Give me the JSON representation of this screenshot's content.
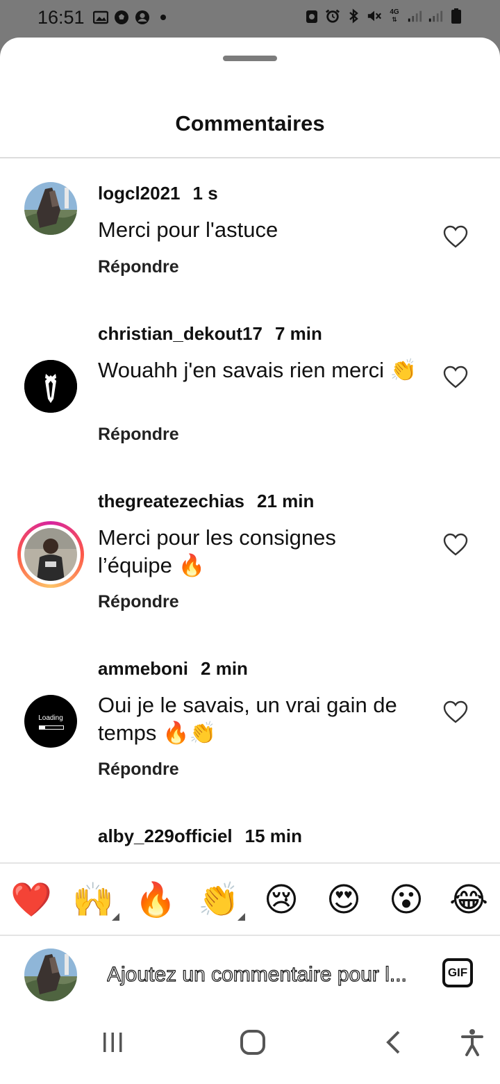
{
  "status_bar": {
    "time": "16:51",
    "left_icons": [
      "gallery-icon",
      "soccer-ball-icon",
      "account-circle-icon",
      "dot-icon"
    ],
    "right_icons": [
      "recycle-icon",
      "alarm-icon",
      "bluetooth-icon",
      "mute-icon",
      "4g-icon",
      "signal-icon",
      "signal-icon",
      "battery-icon"
    ],
    "network": "4G"
  },
  "sheet": {
    "title": "Commentaires"
  },
  "comments": [
    {
      "username": "logcl2021",
      "time": "1 s",
      "text": "Merci pour l'astuce",
      "reply": "Répondre",
      "avatar": "photo"
    },
    {
      "username": "christian_dekout17",
      "time": "7 min",
      "text": "Wouahh j'en savais rien merci 👏",
      "reply": "Répondre",
      "avatar": "tuxedo"
    },
    {
      "username": "thegreatezechias",
      "time": "21 min",
      "text": "Merci pour les consignes l’équipe 🔥",
      "reply": "Répondre",
      "avatar": "story"
    },
    {
      "username": "ammeboni",
      "time": "2 min",
      "text": "Oui je le savais, un vrai gain de temps 🔥👏",
      "reply": "Répondre",
      "avatar": "loading",
      "avatar_text": "Loading"
    },
    {
      "username": "alby_229officiel",
      "time": "15 min",
      "text": "",
      "reply": "",
      "avatar": "photo"
    }
  ],
  "emoji_bar": [
    {
      "emoji": "❤️",
      "name": "heart-emoji",
      "has_variants": false
    },
    {
      "emoji": "🙌",
      "name": "raised-hands-emoji",
      "has_variants": true
    },
    {
      "emoji": "🔥",
      "name": "fire-emoji",
      "has_variants": false
    },
    {
      "emoji": "👏",
      "name": "clapping-hands-emoji",
      "has_variants": true
    },
    {
      "emoji": "😢",
      "name": "crying-face-emoji",
      "has_variants": false
    },
    {
      "emoji": "😍",
      "name": "heart-eyes-emoji",
      "has_variants": false
    },
    {
      "emoji": "😮",
      "name": "surprised-face-emoji",
      "has_variants": false
    },
    {
      "emoji": "😂",
      "name": "tears-of-joy-emoji",
      "has_variants": false
    }
  ],
  "composer": {
    "placeholder": "Ajoutez un commentaire pour l...",
    "gif_label": "GIF"
  },
  "nav_bar": {
    "items": [
      "recent-apps-icon",
      "home-icon",
      "back-icon",
      "accessibility-icon"
    ]
  },
  "colors": {
    "status_bar_bg": "#7a7a7a",
    "sheet_bg": "#ffffff",
    "text": "#111111",
    "divider": "#dcdcdc"
  }
}
